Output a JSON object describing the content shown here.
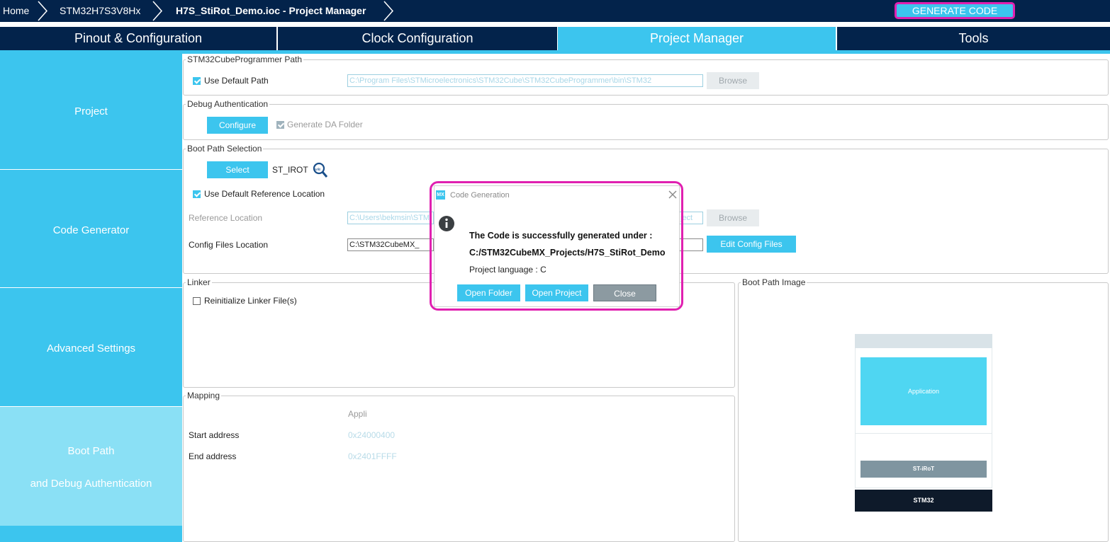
{
  "breadcrumb": {
    "home": "Home",
    "device": "STM32H7S3V8Hx",
    "project": "H7S_StiRot_Demo.ioc - Project Manager"
  },
  "generate_code": "GENERATE CODE",
  "tabs": [
    "Pinout & Configuration",
    "Clock Configuration",
    "Project Manager",
    "Tools"
  ],
  "sidebar": {
    "project": "Project",
    "code_generator": "Code Generator",
    "advanced_settings": "Advanced Settings",
    "boot_path_line1": "Boot Path",
    "boot_path_line2": "and Debug Authentication"
  },
  "programmer": {
    "title": "STM32CubeProgrammer Path",
    "use_default": "Use Default Path",
    "path": "C:\\Program Files\\STMicroelectronics\\STM32Cube\\STM32CubeProgrammer\\bin\\STM32",
    "browse": "Browse"
  },
  "debug_auth": {
    "title": "Debug Authentication",
    "configure": "Configure",
    "generate_da": "Generate DA Folder"
  },
  "boot_path_sel": {
    "title": "Boot Path Selection",
    "select": "Select",
    "value": "ST_IROT",
    "wiki_icon": "magnifier-wiki-icon",
    "use_default_ref": "Use Default Reference Location",
    "ref_location_label": "Reference Location",
    "ref_location_value": "C:\\Users\\bekmsin\\STM",
    "ref_location_tail": "ject",
    "browse": "Browse",
    "config_files_label": "Config Files Location",
    "config_files_value": "C:\\STM32CubeMX_",
    "edit_config": "Edit Config Files"
  },
  "linker": {
    "title": "Linker",
    "reinit": "Reinitialize Linker File(s)"
  },
  "mapping": {
    "title": "Mapping",
    "column": "Appli",
    "start_label": "Start address",
    "start_value": "0x24000400",
    "end_label": "End address",
    "end_value": "0x2401FFFF"
  },
  "boot_image": {
    "title": "Boot Path Image",
    "application": "Application",
    "st_irot": "ST-iRoT",
    "stm32": "STM32"
  },
  "dialog": {
    "badge": "MX",
    "title": "Code Generation",
    "line1": "The Code is successfully generated under :",
    "line2": "C:/STM32CubeMX_Projects/H7S_StiRot_Demo",
    "line3": "Project language : C",
    "open_folder": "Open Folder",
    "open_project": "Open Project",
    "close": "Close"
  },
  "colors": {
    "navy": "#03234b",
    "accent": "#3cc5ee",
    "highlight": "#e020b0"
  }
}
